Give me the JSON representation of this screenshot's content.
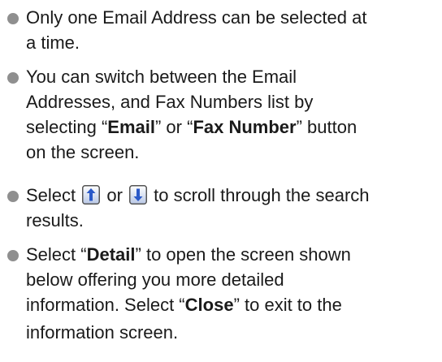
{
  "bullets": [
    {
      "lines": [
        "Only one Email Address can be selected at",
        "a time."
      ]
    },
    {
      "l1": "You can switch between the Email",
      "l2": "Addresses, and Fax Numbers list by",
      "l3_pre": "selecting “",
      "email": "Email",
      "l3_mid": "” or “",
      "fax": "Fax Number",
      "l3_post": "” button",
      "l4": "on the screen."
    },
    {
      "pre": "Select ",
      "mid": " or ",
      "post": " to scroll through the search",
      "l2": "results.",
      "icons": [
        "up-arrow-icon",
        "down-arrow-icon"
      ]
    },
    {
      "l1_pre": "Select “",
      "detail": "Detail",
      "l1_post": "” to open the screen shown",
      "l2": "below offering you more detailed",
      "l3_pre": "information. Select “",
      "close": "Close",
      "l3_post": "” to exit to the",
      "l4": "information screen."
    }
  ],
  "colors": {
    "bullet": "#8f8f8f",
    "icon_border": "#555555",
    "icon_fill_top": "#ffffff",
    "icon_fill_bottom": "#b9c8e6",
    "arrow_blue": "#2a59c8"
  }
}
